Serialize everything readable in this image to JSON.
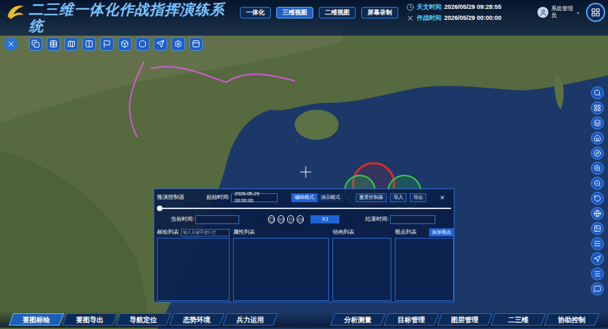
{
  "app": {
    "title": "二三维一体化作战指挥演练系统"
  },
  "top_nav": [
    {
      "label": "一体化",
      "selected": false
    },
    {
      "label": "三维视图",
      "selected": true
    },
    {
      "label": "二维视图",
      "selected": false
    },
    {
      "label": "屏幕录制",
      "selected": false
    }
  ],
  "clock": [
    {
      "label": "天文时间",
      "value": "2026/05/29 09:28:55"
    },
    {
      "label": "作战时间",
      "value": "2026/05/29 00:00:00"
    }
  ],
  "user": {
    "name": "系统管理员"
  },
  "controller": {
    "title": "推演控制器",
    "start_label": "起始时间:",
    "start_value": "2026-05-29 00:00:00",
    "modes": [
      {
        "label": "编辑模式",
        "selected": true
      },
      {
        "label": "演示模式",
        "selected": false
      }
    ],
    "buttons": [
      "重置控制器",
      "导入",
      "导出"
    ],
    "close": "×",
    "progress": {
      "level": 0
    },
    "current_label": "当前时间:",
    "speed": "X1",
    "end_label": "结束时间:",
    "panels": [
      {
        "title": "标绘列表",
        "search_placeholder": "输入关键字进行过"
      },
      {
        "title": "属性列表"
      },
      {
        "title": "动画列表"
      },
      {
        "title": "视点列表",
        "button": "添加视点"
      }
    ]
  },
  "bottom_nav": [
    {
      "label": "要图标绘",
      "selected": true
    },
    {
      "label": "要图导出",
      "selected": false
    },
    {
      "label": "导航定位",
      "selected": false
    },
    {
      "label": "态势环境",
      "selected": false
    },
    {
      "label": "兵力运用",
      "selected": false
    },
    {
      "label": "分析测量",
      "selected": false
    },
    {
      "label": "目标管理",
      "selected": false
    },
    {
      "label": "图层管理",
      "selected": false
    },
    {
      "label": "二三维",
      "selected": false
    },
    {
      "label": "协助控制",
      "selected": false
    }
  ]
}
